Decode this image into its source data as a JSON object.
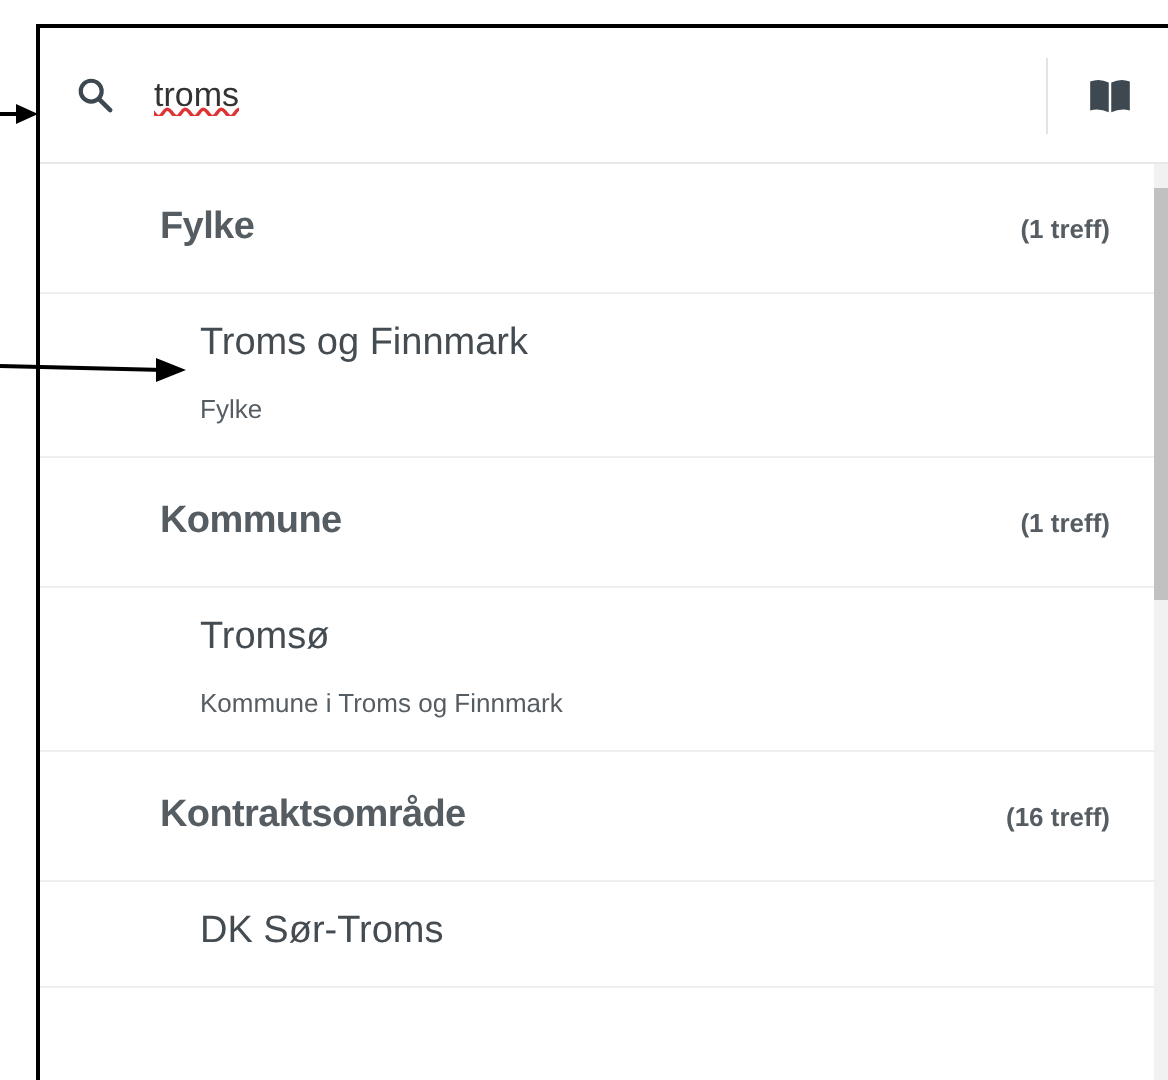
{
  "search": {
    "value": "troms"
  },
  "groups": [
    {
      "title": "Fylke",
      "count": "(1 treff)",
      "results": [
        {
          "title": "Troms og Finnmark",
          "subtitle": "Fylke"
        }
      ]
    },
    {
      "title": "Kommune",
      "count": "(1 treff)",
      "results": [
        {
          "title": "Tromsø",
          "subtitle": "Kommune i Troms og Finnmark"
        }
      ]
    },
    {
      "title": "Kontraktsområde",
      "count": "(16 treff)",
      "results": [
        {
          "title": "DK Sør-Troms"
        }
      ]
    }
  ]
}
